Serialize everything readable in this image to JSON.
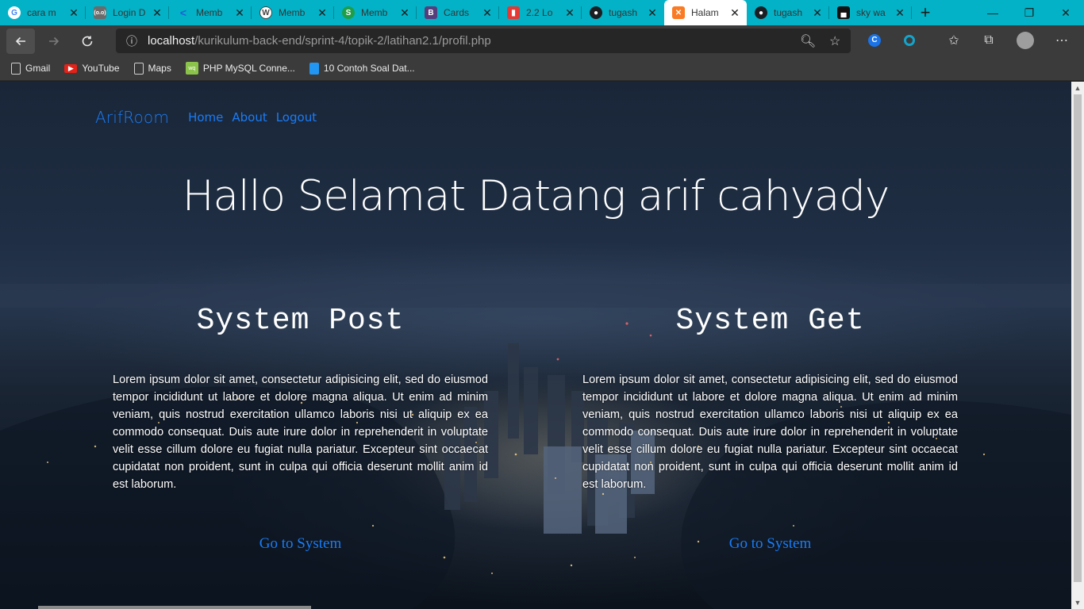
{
  "tabs": [
    {
      "title": "cara m",
      "icon": "google-icon",
      "color": "#ffffff"
    },
    {
      "title": "Login D",
      "icon": "login-page-icon",
      "color": "#6b6b6b"
    },
    {
      "title": "Memb",
      "icon": "membership-icon",
      "color": "#1e88e5"
    },
    {
      "title": "Memb",
      "icon": "wordpress-icon",
      "color": "#464342"
    },
    {
      "title": "Memb",
      "icon": "s-icon",
      "color": "#1e9e48"
    },
    {
      "title": "Cards",
      "icon": "bootstrap-icon",
      "color": "#563d7c"
    },
    {
      "title": "2.2 Lo",
      "icon": "course-icon",
      "color": "#e53935"
    },
    {
      "title": "tugash",
      "icon": "github-icon",
      "color": "#1b1f23"
    },
    {
      "title": "Halam",
      "icon": "xampp-icon",
      "color": "#fb7a24",
      "active": true
    },
    {
      "title": "tugash",
      "icon": "github-icon",
      "color": "#1b1f23"
    },
    {
      "title": "sky wa",
      "icon": "unsplash-icon",
      "color": "#111111"
    }
  ],
  "window_controls": {
    "minimize": "—",
    "maximize": "❐",
    "close": "✕"
  },
  "address_bar": {
    "host": "localhost",
    "path": "/kurikulum-back-end/sprint-4/topik-2/latihan2.1/profil.php"
  },
  "bookmarks": [
    {
      "label": "Gmail",
      "icon": "page-icon",
      "color": "#3b3b3b"
    },
    {
      "label": "YouTube",
      "icon": "youtube-icon",
      "color": "#e62117"
    },
    {
      "label": "Maps",
      "icon": "page-icon",
      "color": "#3b3b3b"
    },
    {
      "label": "PHP MySQL Conne...",
      "icon": "php-icon",
      "color": "#8bc34a"
    },
    {
      "label": "10 Contoh Soal Dat...",
      "icon": "doc-icon",
      "color": "#2196f3"
    }
  ],
  "site": {
    "brand": "ArifRoom",
    "nav": [
      "Home",
      "About",
      "Logout"
    ],
    "hero": "Hallo Selamat Datang arif cahyady",
    "sections": [
      {
        "title": "System Post",
        "text": "Lorem ipsum dolor sit amet, consectetur adipisicing elit, sed do eiusmod tempor incididunt ut labore et dolore magna aliqua. Ut enim ad minim veniam, quis nostrud exercitation ullamco laboris nisi ut aliquip ex ea commodo consequat. Duis aute irure dolor in reprehenderit in voluptate velit esse cillum dolore eu fugiat nulla pariatur. Excepteur sint occaecat cupidatat non proident, sunt in culpa qui officia deserunt mollit anim id est laborum.",
        "link": "Go to System"
      },
      {
        "title": "System Get",
        "text": "Lorem ipsum dolor sit amet, consectetur adipisicing elit, sed do eiusmod tempor incididunt ut labore et dolore magna aliqua. Ut enim ad minim veniam, quis nostrud exercitation ullamco laboris nisi ut aliquip ex ea commodo consequat. Duis aute irure dolor in reprehenderit in voluptate velit esse cillum dolore eu fugiat nulla pariatur. Excepteur sint occaecat cupidatat non proident, sunt in culpa qui officia deserunt mollit anim id est laborum.",
        "link": "Go to System"
      }
    ]
  },
  "colors": {
    "tabstrip": "#03b2c6",
    "link": "#1a7cf5",
    "toolbar": "#3b3b3b"
  }
}
